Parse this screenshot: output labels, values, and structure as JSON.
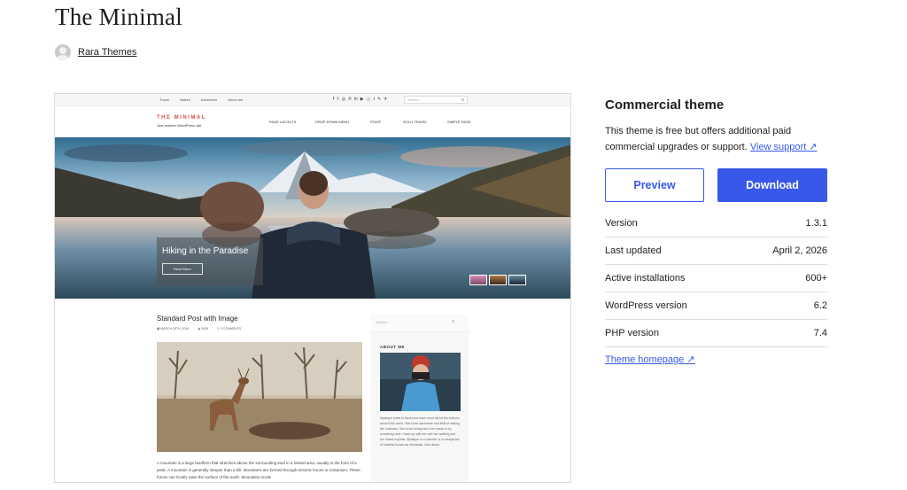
{
  "title": "The Minimal",
  "author": {
    "name": "Rara Themes"
  },
  "preview": {
    "topbar": {
      "nav": [
        "Travel",
        "Nature",
        "Adventure",
        "About me"
      ],
      "social": [
        "f",
        "𝕥",
        "◎",
        "℗",
        "in",
        "▶",
        "ⓥ",
        "t",
        "✎",
        "✈"
      ],
      "search_placeholder": "Search...",
      "search_icon": "search-icon"
    },
    "site": {
      "title": "THE MINIMAL",
      "tagline": "Just another WordPress site"
    },
    "menu": [
      "PAGE LAYOUTS",
      "DROP DOWN MENU",
      "STAFF",
      "SOLO TRAVEL",
      "SIMPLE PAGE"
    ],
    "hero": {
      "caption": "Hiking in the Paradise",
      "button": "Read More"
    },
    "post": {
      "title": "Standard Post with Image",
      "date": "MARCH 30TH, 2016",
      "author": "BOB",
      "comments": "0 COMMENTS",
      "excerpt": "A mountain is a large landform that stretches above the surrounding land in a limited area, usually in the form of a peak. A mountain is generally steeper than a hill. Mountains are formed through tectonic forces or volcanism. These forces can locally raise the surface of the earth. Mountains erode"
    },
    "sidebar": {
      "search_placeholder": "Search...",
      "about_label": "ABOUT ME",
      "about_text": "Mystique loves to travel and learn more about the cultures around the world. She loves adventure and thrill of visiting the unknown. She is fun loving and ever ready to try something new. Catch up with her with her walking and fun based exploits. Mystique is a member of a subspecies of butterfly known as elephants, who dance"
    }
  },
  "panel": {
    "title": "Commercial theme",
    "description": "This theme is free but offers additional paid commercial upgrades or support.",
    "support_link": "View support ↗",
    "preview_button": "Preview",
    "download_button": "Download",
    "meta": [
      {
        "label": "Version",
        "value": "1.3.1"
      },
      {
        "label": "Last updated",
        "value": "April 2, 2026"
      },
      {
        "label": "Active installations",
        "value": "600+"
      },
      {
        "label": "WordPress version",
        "value": "6.2"
      },
      {
        "label": "PHP version",
        "value": "7.4"
      }
    ],
    "homepage_link": "Theme homepage ↗"
  },
  "colors": {
    "accent": "#3858e9",
    "text": "#1e1e1e",
    "logo": "#d9534f",
    "border": "#dcdcdc"
  }
}
